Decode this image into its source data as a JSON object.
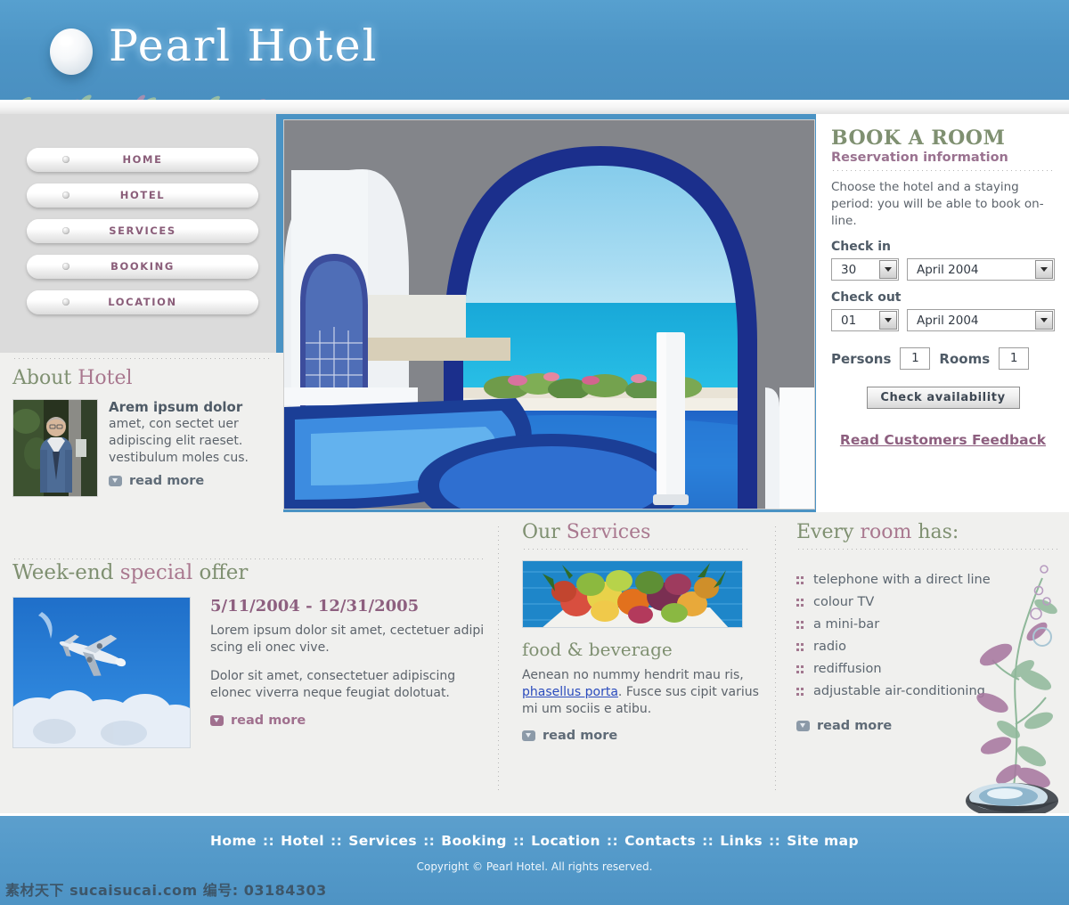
{
  "header": {
    "title": "Pearl Hotel",
    "logo_icon": "pearl-icon"
  },
  "sidebar": {
    "items": [
      {
        "label": "Home"
      },
      {
        "label": "Hotel"
      },
      {
        "label": "Services"
      },
      {
        "label": "Booking"
      },
      {
        "label": "Location"
      }
    ]
  },
  "booking": {
    "title": "BOOK A ROOM",
    "subtitle": "Reservation information",
    "intro": "Choose the hotel and a staying period: you will be able to book on-line.",
    "checkin_label": "Check in",
    "checkin_day": "30",
    "checkin_month": "April 2004",
    "checkout_label": "Check out",
    "checkout_day": "01",
    "checkout_month": "April 2004",
    "persons_label": "Persons",
    "persons_value": "1",
    "rooms_label": "Rooms",
    "rooms_value": "1",
    "check_button": "Check availability",
    "feedback_link": "Read Customers Feedback"
  },
  "about": {
    "title_part1": "About",
    "title_part2": "Hotel",
    "lead": "Arem ipsum dolor",
    "body": "amet, con sectet uer adipiscing elit raeset. vestibulum moles cus.",
    "read_more": "read more"
  },
  "weekend": {
    "title_part1": "Week-end",
    "title_part2": "special",
    "title_part3": "offer",
    "date_range": "5/11/2004 - 12/31/2005",
    "paragraph1": "Lorem ipsum dolor sit amet, cectetuer adipi scing eli onec vive.",
    "paragraph2": "Dolor sit amet, consectetuer adipiscing elonec viverra neque feugiat dolotuat.",
    "read_more": "read more"
  },
  "services": {
    "title_part1": "Our",
    "title_part2": "Services",
    "subtitle": "food  &  beverage",
    "body_before_link": "Aenean no nummy hendrit mau ris, ",
    "link_text": "phasellus porta",
    "body_after_link": ". Fusce sus cipit varius mi um sociis e atibu.",
    "read_more": "read more"
  },
  "rooms": {
    "title_part1": "Every",
    "title_part2": "room",
    "title_part3": "has:",
    "items": [
      "telephone with a direct line",
      "colour TV",
      "a mini-bar",
      "radio",
      "rediffusion",
      "adjustable air-conditioning"
    ],
    "read_more": "read more"
  },
  "footer": {
    "links": [
      "Home",
      "Hotel",
      "Services",
      "Booking",
      "Location",
      "Contacts",
      "Links",
      "Site map"
    ],
    "separator": "::",
    "copyright": "Copyright © Pearl Hotel. All rights reserved."
  },
  "watermark": "素材天下 sucaisucai.com  编号: 03184303",
  "colors": {
    "brand_blue": "#4a93c4",
    "sage_green": "#7f9071",
    "mauve": "#a9788f",
    "nav_text": "#8a5d79",
    "link_blue": "#2a4bbd"
  }
}
